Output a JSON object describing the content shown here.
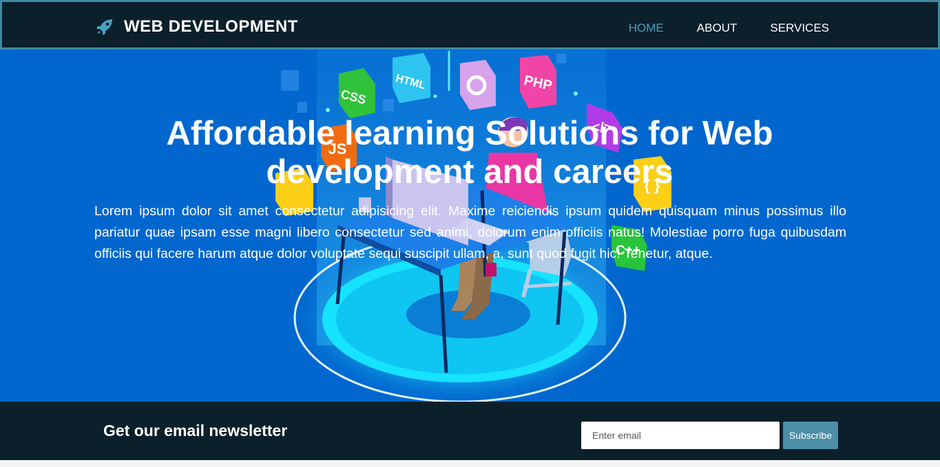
{
  "navbar": {
    "brand_icon": "rocket-icon",
    "brand_title": "WEB DEVELOPMENT",
    "links": [
      {
        "label": "HOME",
        "active": true
      },
      {
        "label": "ABOUT",
        "active": false
      },
      {
        "label": "SERVICES",
        "active": false
      }
    ]
  },
  "hero": {
    "heading": "Affordable learning Solutions for Web development and careers",
    "paragraph": "Lorem ipsum dolor sit amet consectetur adipisicing elit. Maxime reiciendis ipsum quidem quisquam minus possimus illo pariatur quae ipsam esse magni libero consectetur sed animi, dolorum enim officiis natus! Molestiae porro fuga quibusdam officiis qui facere harum atque dolor voluptate sequi suscipit ullam, a, sunt quod fugit hic! Tenetur, atque.",
    "illustration_badges": [
      "CSS",
      "HTML",
      "PHP",
      "JS",
      "</>",
      "{ }",
      "C++"
    ]
  },
  "newsletter": {
    "heading": "Get our email newsletter",
    "email_placeholder": "Enter email",
    "subscribe_label": "Subscribe"
  },
  "colors": {
    "navbar_bg": "#0b202b",
    "navbar_border": "#3f8aa3",
    "hero_bg": "#0167ce",
    "active_link": "#4d9fc0",
    "subscribe_bg": "#4d8ea7"
  }
}
